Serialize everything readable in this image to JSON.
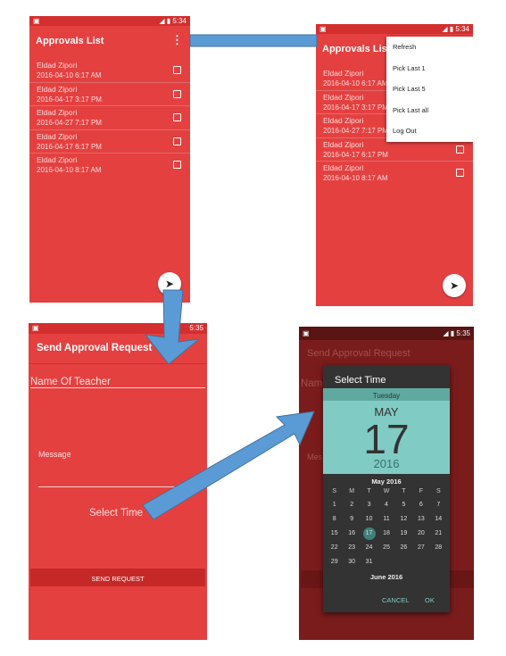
{
  "colors": {
    "primary": "#e54040",
    "status": "#d32f2f",
    "dialog_teal": "#80cbc4",
    "dialog_dark": "#333333",
    "accent": "#009688",
    "arrow": "#5b9bd5"
  },
  "status": {
    "time1": "5:34",
    "time2": "5:34",
    "time3": "5:35",
    "time4": "5:35"
  },
  "approvals": {
    "title": "Approvals List",
    "items": [
      {
        "name": "Eldad Zipori",
        "date": "2016-04-10 6:17 AM"
      },
      {
        "name": "Eldad Zipori",
        "date": "2016-04-17 3:17 PM"
      },
      {
        "name": "Eldad Zipori",
        "date": "2016-04-27 7:17 PM"
      },
      {
        "name": "Eldad Zipori",
        "date": "2016-04-17 6:17 PM"
      },
      {
        "name": "Eldad Zipori",
        "date": "2016-04-10 8:17 AM"
      }
    ]
  },
  "menu": {
    "items": [
      "Refresh",
      "Pick Last 1",
      "Pick Last 5",
      "Pick Last all",
      "Log Out"
    ]
  },
  "send": {
    "title": "Send Approval Request",
    "teacher_placeholder": "Name Of Teacher",
    "message_label": "Message",
    "select_time": "Select Time",
    "send_button": "SEND REQUEST"
  },
  "dialog": {
    "title": "Select Time",
    "weekday": "Tuesday",
    "month": "MAY",
    "day": "17",
    "year": "2016",
    "cal_title": "May 2016",
    "weekdays": [
      "S",
      "M",
      "T",
      "W",
      "T",
      "F",
      "S"
    ],
    "weeks": [
      [
        "1",
        "2",
        "3",
        "4",
        "5",
        "6",
        "7"
      ],
      [
        "8",
        "9",
        "10",
        "11",
        "12",
        "13",
        "14"
      ],
      [
        "15",
        "16",
        "17",
        "18",
        "19",
        "20",
        "21"
      ],
      [
        "22",
        "23",
        "24",
        "25",
        "26",
        "27",
        "28"
      ],
      [
        "29",
        "30",
        "31",
        "",
        "",
        "",
        ""
      ]
    ],
    "selected": "17",
    "next_month": "June 2016",
    "cancel": "CANCEL",
    "ok": "OK",
    "bg_title": "Send Approval Request",
    "bg_field": "Nam",
    "bg_msg": "Mes"
  }
}
